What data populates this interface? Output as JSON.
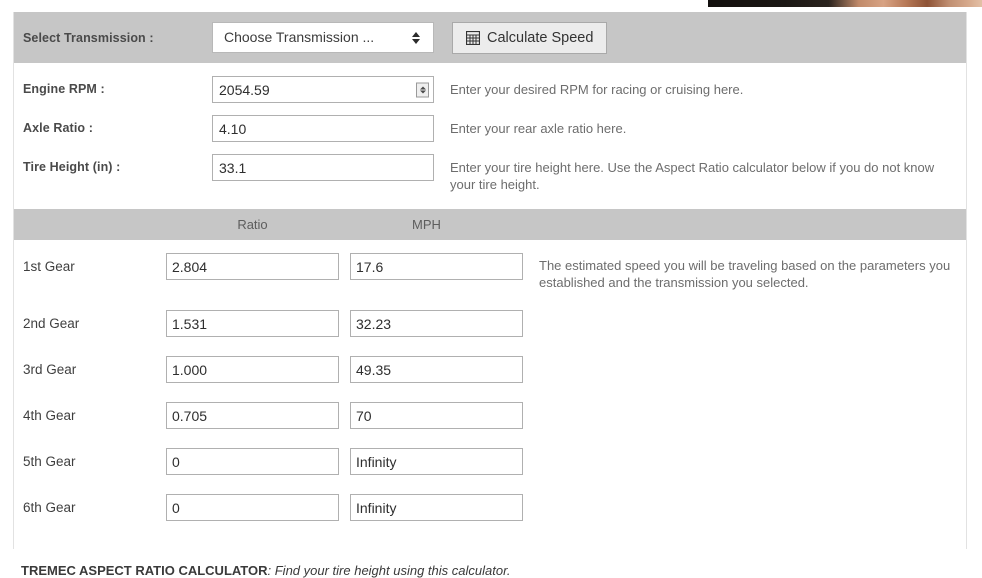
{
  "banner": {
    "alt": "partial-photo-banner-strip"
  },
  "form": {
    "transmission": {
      "label": "Select Transmission :",
      "selected": "Choose Transmission ...",
      "options": [
        "Choose Transmission ..."
      ]
    },
    "calculate_button": {
      "label": "Calculate Speed",
      "icon": "calculator-icon"
    },
    "fields": [
      {
        "label": "Engine RPM :",
        "value": "2054.59",
        "hint": "Enter your desired RPM for racing or cruising here.",
        "spinner": true
      },
      {
        "label": "Axle Ratio :",
        "value": "4.10",
        "hint": "Enter your rear axle ratio here.",
        "spinner": false
      },
      {
        "label": "Tire Height (in) :",
        "value": "33.1",
        "hint": "Enter your tire height here. Use the Aspect Ratio calculator below if you do not know your tire height.",
        "spinner": false
      }
    ]
  },
  "gear_table": {
    "headers": {
      "spacer": "",
      "ratio": "Ratio",
      "mph": "MPH"
    },
    "rows": [
      {
        "gear": "1st Gear",
        "ratio": "2.804",
        "mph": "17.6"
      },
      {
        "gear": "2nd Gear",
        "ratio": "1.531",
        "mph": "32.23"
      },
      {
        "gear": "3rd Gear",
        "ratio": "1.000",
        "mph": "49.35"
      },
      {
        "gear": "4th Gear",
        "ratio": "0.705",
        "mph": "70"
      },
      {
        "gear": "5th Gear",
        "ratio": "0",
        "mph": "Infinity"
      },
      {
        "gear": "6th Gear",
        "ratio": "0",
        "mph": "Infinity"
      }
    ],
    "note": "The estimated speed you will be traveling based on the parameters you established and the transmission you selected."
  },
  "footer": {
    "note_bold": "TREMEC ASPECT RATIO CALCULATOR",
    "note_rest": ": Find your tire height using this calculator."
  },
  "colors": {
    "band": "#c6c6c6",
    "page": "#ffffff",
    "label": "#4a4a4a",
    "hint": "#6d6d6d",
    "border": "#b0b0b0"
  }
}
